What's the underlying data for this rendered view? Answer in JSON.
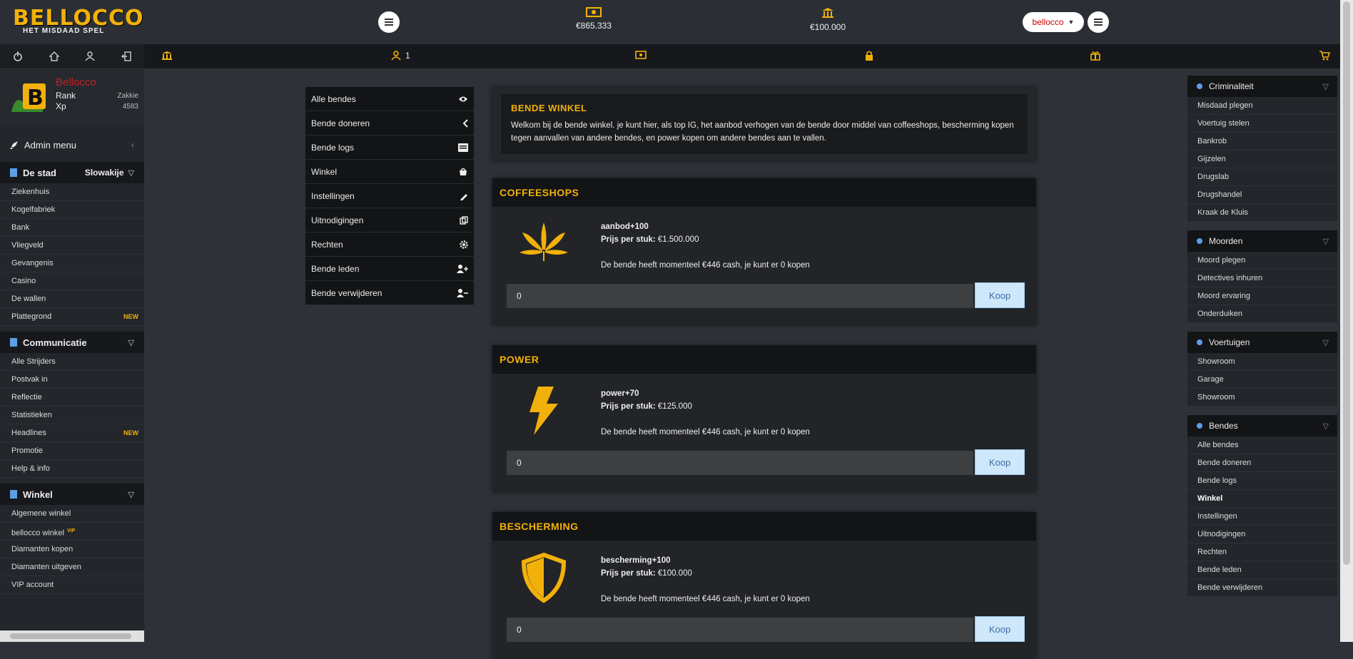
{
  "header": {
    "logo_title": "BELLOCCO",
    "logo_sub": "HET MISDAAD SPEL",
    "cash": "€865.333",
    "bank": "€100.000",
    "language": "bellocco"
  },
  "side_icons": [
    "power-icon",
    "home-icon",
    "user-icon",
    "logout-icon"
  ],
  "profile": {
    "username": "Bellocco",
    "rank_label": "Rank",
    "xp_label": "Xp",
    "rank_value": "Zakkie",
    "xp_value": "4583"
  },
  "admin": {
    "label": "Admin menu",
    "chevron": "‹"
  },
  "groups": [
    {
      "title": "De stad",
      "extra": "Slowakije",
      "items": [
        {
          "label": "Ziekenhuis"
        },
        {
          "label": "Kogelfabriek"
        },
        {
          "label": "Bank"
        },
        {
          "label": "Vliegveld"
        },
        {
          "label": "Gevangenis"
        },
        {
          "label": "Casino"
        },
        {
          "label": "De wallen"
        },
        {
          "label": "Plattegrond",
          "badge": "NEW"
        }
      ]
    },
    {
      "title": "Communicatie",
      "extra": "",
      "items": [
        {
          "label": "Alle Strijders"
        },
        {
          "label": "Postvak in"
        },
        {
          "label": "Reflectie"
        },
        {
          "label": "Statistieken"
        },
        {
          "label": "Headlines",
          "badge": "NEW"
        },
        {
          "label": "Promotie"
        },
        {
          "label": "Help & info"
        }
      ]
    },
    {
      "title": "Winkel",
      "extra": "",
      "items": [
        {
          "label": "Algemene winkel"
        },
        {
          "label": "bellocco winkel",
          "badge": "VIP"
        },
        {
          "label": "Diamanten kopen"
        },
        {
          "label": "Diamanten uitgeven"
        },
        {
          "label": "VIP account"
        }
      ]
    }
  ],
  "toolbar": {
    "online_count": "1"
  },
  "gang_menu": [
    {
      "label": "Alle bendes",
      "icon": "eye-icon"
    },
    {
      "label": "Bende doneren",
      "icon": "chevron-left-icon"
    },
    {
      "label": "Bende logs",
      "icon": "list-icon"
    },
    {
      "label": "Winkel",
      "icon": "shop-icon"
    },
    {
      "label": "Instellingen",
      "icon": "pencil-icon"
    },
    {
      "label": "Uitnodigingen",
      "icon": "copy-icon"
    },
    {
      "label": "Rechten",
      "icon": "gear-icon"
    },
    {
      "label": "Bende leden",
      "icon": "user-plus-icon"
    },
    {
      "label": "Bende verwijderen",
      "icon": "user-minus-icon"
    }
  ],
  "welcome": {
    "title": "BENDE WINKEL",
    "text": "Welkom bij de bende winkel. je kunt hier, als top IG, het aanbod verhogen van de bende door middel van coffeeshops, bescherming kopen tegen aanvallen van andere bendes, en power kopen om andere bendes aan te vallen."
  },
  "shops": [
    {
      "title": "COFFEESHOPS",
      "icon": "cannabis-leaf-icon",
      "line1": "aanbod+100",
      "price_label": "Prijs per stuk:",
      "price": "€1.500.000",
      "info": "De bende heeft momenteel €446 cash, je kunt er 0 kopen",
      "input": "0",
      "button": "Koop"
    },
    {
      "title": "POWER",
      "icon": "lightning-icon",
      "line1": "power+70",
      "price_label": "Prijs per stuk:",
      "price": "€125.000",
      "info": "De bende heeft momenteel €446 cash, je kunt er 0 kopen",
      "input": "0",
      "button": "Koop"
    },
    {
      "title": "BESCHERMING",
      "icon": "shield-icon",
      "line1": "bescherming+100",
      "price_label": "Prijs per stuk:",
      "price": "€100.000",
      "info": "De bende heeft momenteel €446 cash, je kunt er 0 kopen",
      "input": "0",
      "button": "Koop"
    }
  ],
  "right_groups": [
    {
      "title": "Criminaliteit",
      "items": [
        "Misdaad plegen",
        "Voertuig stelen",
        "Bankrob",
        "Gijzelen",
        "Drugslab",
        "Drugshandel",
        "Kraak de Kluis"
      ],
      "active": ""
    },
    {
      "title": "Moorden",
      "items": [
        "Moord plegen",
        "Detectives inhuren",
        "Moord ervaring",
        "Onderduiken"
      ],
      "active": ""
    },
    {
      "title": "Voertuigen",
      "items": [
        "Showroom",
        "Garage",
        "Showroom"
      ],
      "active": ""
    },
    {
      "title": "Bendes",
      "items": [
        "Alle bendes",
        "Bende doneren",
        "Bende logs",
        "Winkel",
        "Instellingen",
        "Uitnodigingen",
        "Rechten",
        "Bende leden",
        "Bende verwijderen"
      ],
      "active": "Winkel"
    }
  ],
  "colors": {
    "accent": "#f2b10a",
    "background": "#2e3238",
    "panel": "#1f2124",
    "username": "#c42020",
    "button": "#cfe7fb"
  }
}
